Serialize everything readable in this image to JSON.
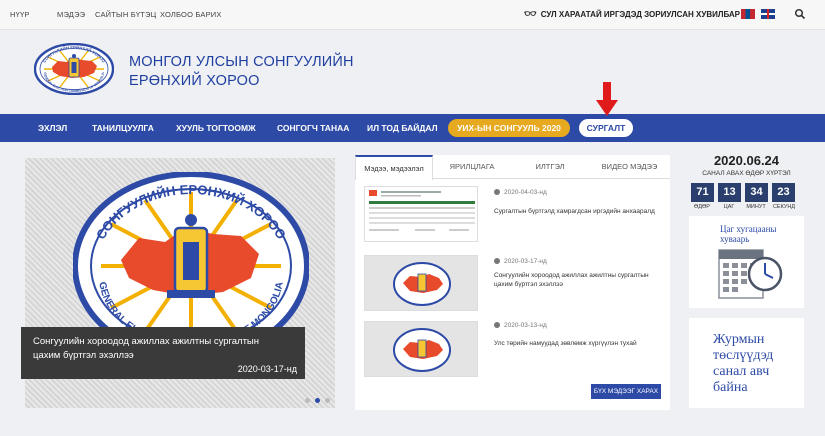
{
  "topbar": {
    "links": [
      "НҮҮР",
      "МЭДЭЭ",
      "САЙТЫН БҮТЭЦ",
      "ХОЛБОО БАРИХ"
    ],
    "accessibility": "СУЛ ХАРААТАЙ ИРГЭДЭД ЗОРИУЛСАН ХУВИЛБАР",
    "icons": [
      "glasses-icon",
      "flag-mongolia-icon",
      "flag-uk-icon",
      "search-icon"
    ]
  },
  "header": {
    "title_line1": "МОНГОЛ УЛСЫН СОНГУУЛИЙН",
    "title_line2": "ЕРӨНХИЙ ХОРОО",
    "logo_top": "СОНГУУЛИЙН ЕРӨНХИЙ ХОРОО",
    "logo_bottom": "GENERAL ELECTION COMMISSION OF MONGOLIA"
  },
  "nav": {
    "items": [
      "ЭХЛЭЛ",
      "ТАНИЛЦУУЛГА",
      "ХУУЛЬ ТОГТООМЖ",
      "СОНГОГЧ ТАНАА",
      "ИЛ ТОД БАЙДАЛ"
    ],
    "election_pill": "УИХ-ЫН СОНГУУЛЬ 2020",
    "training_pill": "СУРГАЛТ"
  },
  "slider": {
    "caption": "Сонгуулийн хороодод ажиллах ажилтны сургалтын цахим бүртгэл эхэллээ",
    "date": "2020-03-17-нд",
    "emblem_top": "СОНГУУЛИЙН ЕРӨНХИЙ ХОРОО",
    "emblem_bottom": "GENERAL ELECTION COMMISSION OF MONGOLIA"
  },
  "news": {
    "tabs": [
      "Мэдээ, мэдээлэл",
      "ЯРИЛЦЛАГА",
      "ИЛТГЭЛ",
      "ВИДЕО МЭДЭЭ"
    ],
    "items": [
      {
        "date": "2020-04-03-нд",
        "title": "Сургалтын бүртгэлд хамрагдсан иргэдийн анхааралд"
      },
      {
        "date": "2020-03-17-нд",
        "title": "Сонгуулийн хороодод ажиллах ажилтны сургалтын цахим бүртгэл эхэллээ"
      },
      {
        "date": "2020-03-13-нд",
        "title": "Улс төрийн намуудад зөвлөмж хүргүүлэн тухай"
      }
    ],
    "more_button": "БҮХ МЭДЭЭГ ХАРАХ"
  },
  "countdown": {
    "date": "2020.06.24",
    "subtitle": "САНАЛ АВАХ ӨДӨР ХҮРТЭЛ",
    "units": [
      {
        "value": "71",
        "label": "ӨДӨР"
      },
      {
        "value": "13",
        "label": "ЦАГ"
      },
      {
        "value": "34",
        "label": "МИНУТ"
      },
      {
        "value": "23",
        "label": "СЕКУНД"
      }
    ]
  },
  "calendar_card": {
    "title_line1": "Цаг хугацааны",
    "title_line2": "хуваарь"
  },
  "rules_card": {
    "text": "Журмын төслүүдэд санал авч байна"
  },
  "colors": {
    "brand_blue": "#2d4aa6",
    "accent_yellow": "#e6a91f",
    "arrow_red": "#e01b1b",
    "countdown_navy": "#2a3f6d"
  }
}
